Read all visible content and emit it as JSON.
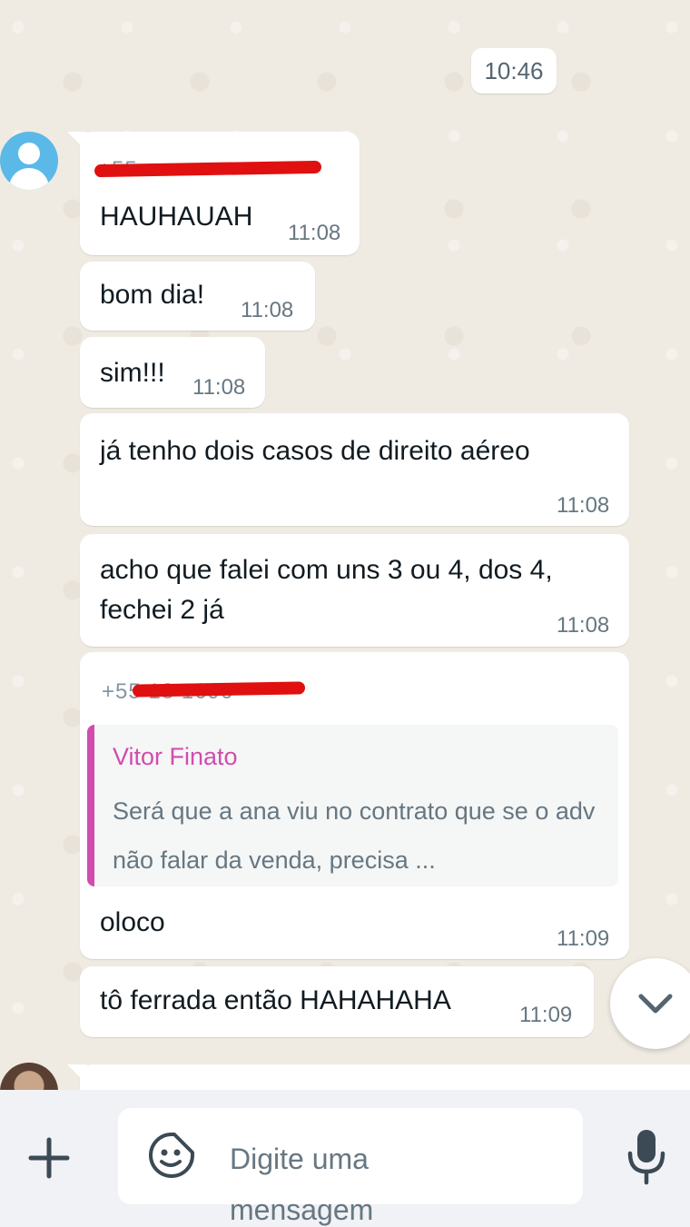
{
  "chat": {
    "date_divider": "10:46",
    "messages": [
      {
        "text": "HAUHAUAH",
        "time": "11:08"
      },
      {
        "text": "bom dia!",
        "time": "11:08"
      },
      {
        "text": "sim!!!",
        "time": "11:08"
      },
      {
        "text": "já tenho dois casos de direito aéreo",
        "time": "11:08"
      },
      {
        "text": "acho que falei com uns 3 ou 4, dos 4, fechei 2 já",
        "time": "11:08"
      },
      {
        "text": "oloco",
        "time": "11:09"
      },
      {
        "text": "tô ferrada então HAHAHAHA",
        "time": "11:09"
      }
    ],
    "sender_1": "+55",
    "sender_2": "+55 18 1696",
    "reply": {
      "name": "Vitor Finato",
      "text": "Será que a ana viu no contrato que se o adv não falar da venda, precisa ...",
      "accent_color": "#d14cae"
    }
  },
  "composer": {
    "placeholder": "Digite uma mensagem",
    "icons": [
      "plus-icon",
      "sticker-icon",
      "microphone-icon"
    ]
  },
  "colors": {
    "chat_background": "#efeae2",
    "bubble": "#ffffff",
    "redaction": "#e01010"
  }
}
